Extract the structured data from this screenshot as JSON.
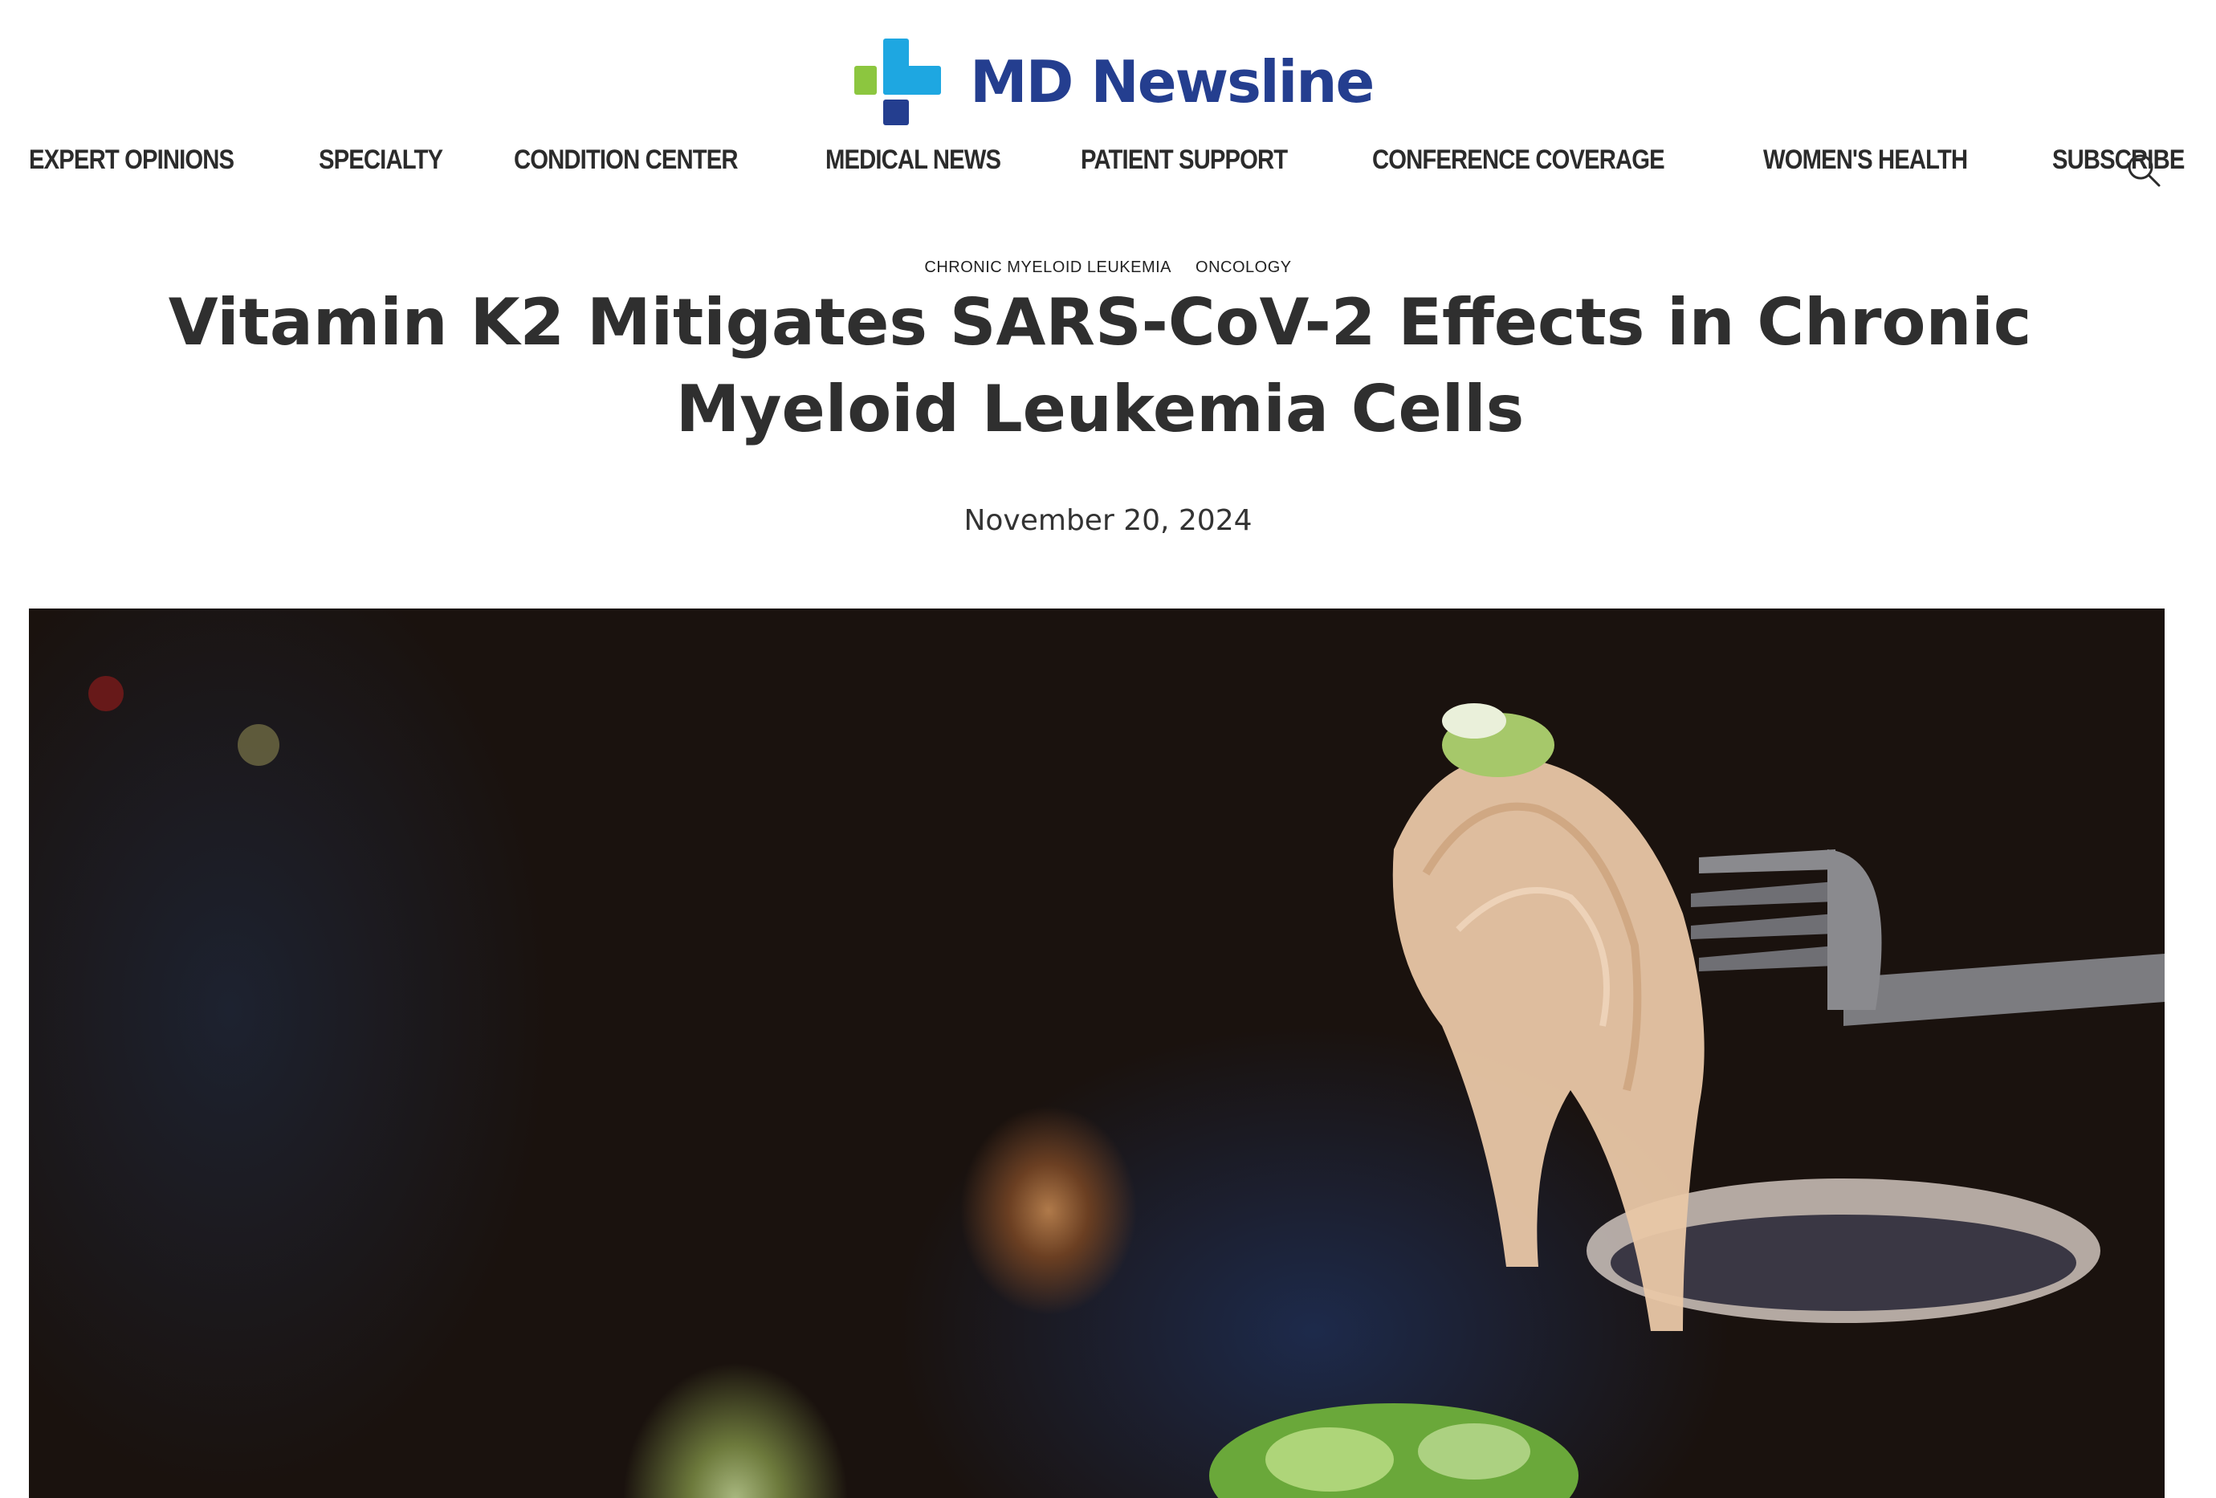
{
  "brand": {
    "name": "MD Newsline",
    "colors": {
      "green": "#8cc63f",
      "cyan": "#1ea7e1",
      "navy": "#243e8f"
    }
  },
  "nav": {
    "items": [
      {
        "label": "EXPERT OPINIONS"
      },
      {
        "label": "SPECIALTY"
      },
      {
        "label": "CONDITION CENTER"
      },
      {
        "label": "MEDICAL NEWS"
      },
      {
        "label": "PATIENT SUPPORT"
      },
      {
        "label": "CONFERENCE COVERAGE"
      },
      {
        "label": "WOMEN'S HEALTH"
      },
      {
        "label": "SUBSCRIBE"
      }
    ],
    "search_icon": "search-icon"
  },
  "article": {
    "tags": [
      "CHRONIC MYELOID LEUKEMIA",
      "ONCOLOGY"
    ],
    "title": "Vitamin K2 Mitigates SARS-CoV-2 Effects in Chronic Myeloid Leukemia Cells",
    "date": "November 20, 2024",
    "hero_image": "photo of sauerkraut on a fork"
  }
}
